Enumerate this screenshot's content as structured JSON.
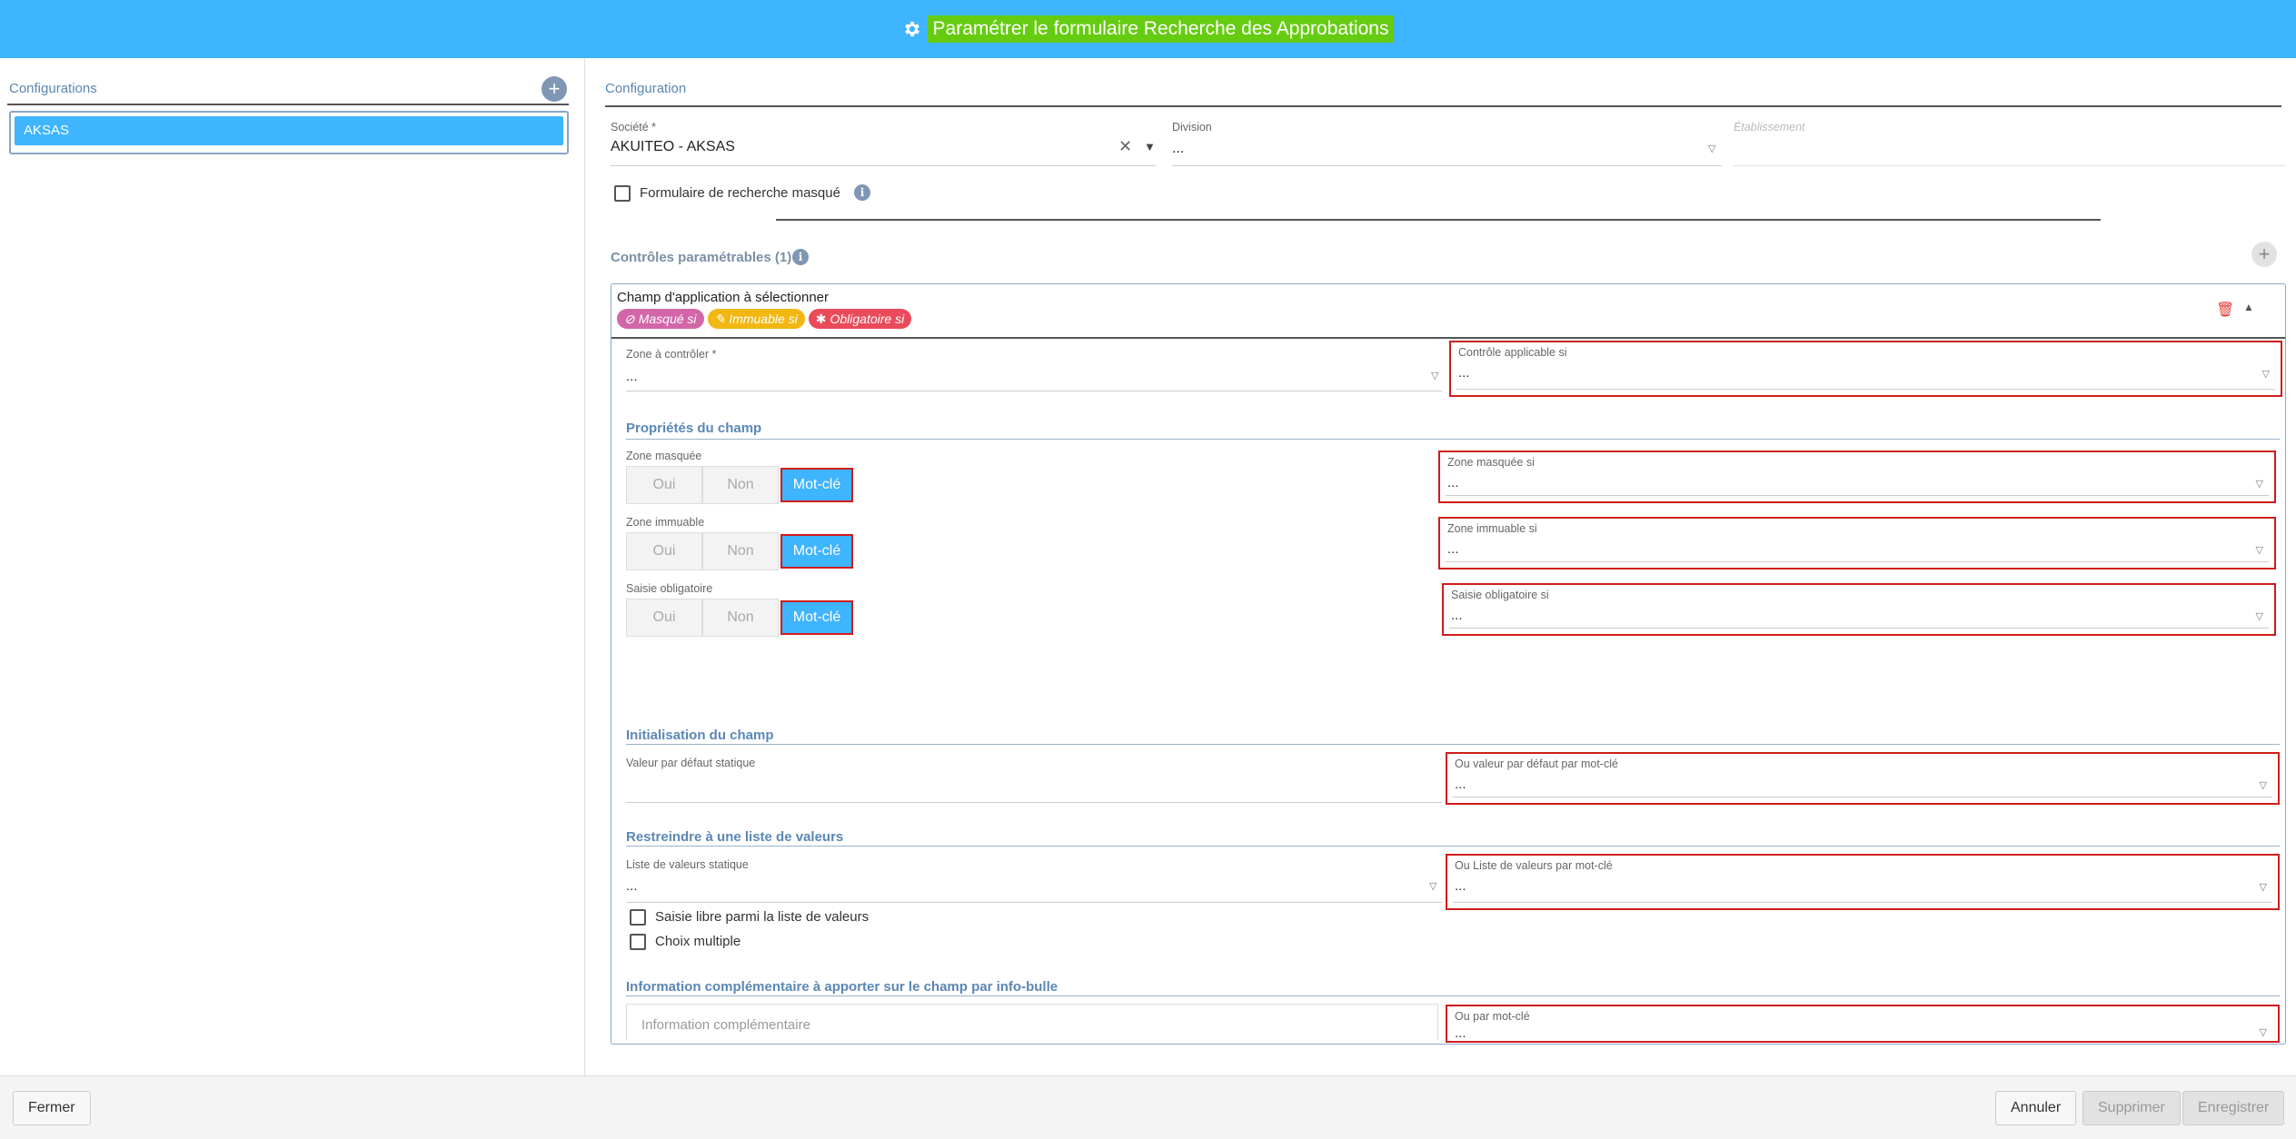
{
  "header": {
    "title": "Paramétrer le formulaire Recherche des Approbations",
    "icon": "gear-icon"
  },
  "left": {
    "title": "Configurations",
    "items": [
      "AKSAS"
    ]
  },
  "right": {
    "title": "Configuration",
    "societe": {
      "label": "Société *",
      "value": "AKUITEO - AKSAS"
    },
    "division": {
      "label": "Division",
      "value": "..."
    },
    "etablissement": {
      "label": "Établissement"
    },
    "masque_checkbox": "Formulaire de recherche masqué",
    "controles_title": "Contrôles paramétrables (1)",
    "card": {
      "title": "Champ d'application à sélectionner",
      "tags": [
        "Masqué si",
        "Immuable si",
        "Obligatoire si"
      ],
      "zone_controler": {
        "label": "Zone à contrôler *",
        "value": "..."
      },
      "controle_applicable": {
        "label": "Contrôle applicable si",
        "value": "..."
      },
      "proprietes_title": "Propriétés du champ",
      "zone_masquee": {
        "label": "Zone masquée",
        "options": [
          "Oui",
          "Non",
          "Mot-clé"
        ],
        "selected": "Mot-clé",
        "cond_label": "Zone masquée si",
        "cond_value": "..."
      },
      "zone_immuable": {
        "label": "Zone immuable",
        "options": [
          "Oui",
          "Non",
          "Mot-clé"
        ],
        "selected": "Mot-clé",
        "cond_label": "Zone immuable si",
        "cond_value": "..."
      },
      "saisie_obligatoire": {
        "label": "Saisie obligatoire",
        "options": [
          "Oui",
          "Non",
          "Mot-clé"
        ],
        "selected": "Mot-clé",
        "cond_label": "Saisie obligatoire si",
        "cond_value": "..."
      },
      "init_title": "Initialisation du champ",
      "valeur_defaut": {
        "label": "Valeur par défaut statique"
      },
      "valeur_motcle": {
        "label": "Ou valeur par défaut par mot-clé",
        "value": "..."
      },
      "restreindre_title": "Restreindre à une liste de valeurs",
      "liste_statique": {
        "label": "Liste de valeurs statique",
        "value": "..."
      },
      "liste_motcle": {
        "label": "Ou Liste de valeurs par mot-clé",
        "value": "..."
      },
      "saisie_libre": "Saisie libre parmi la liste de valeurs",
      "choix_multiple": "Choix multiple",
      "info_title": "Information complémentaire à apporter sur le champ par info-bulle",
      "info_placeholder": "Information complémentaire",
      "info_motcle": {
        "label": "Ou par mot-clé",
        "value": "..."
      }
    }
  },
  "footer": {
    "close": "Fermer",
    "cancel": "Annuler",
    "delete": "Supprimer",
    "save": "Enregistrer"
  },
  "colors": {
    "header": "#3fb4ff",
    "title_highlight": "#66cc11",
    "accent": "#3fb4ff",
    "highlight_border": "#d01c1c",
    "tag_masque": "#d266a8",
    "tag_immuable": "#f2b713",
    "tag_obligatoire": "#e94b5b"
  }
}
